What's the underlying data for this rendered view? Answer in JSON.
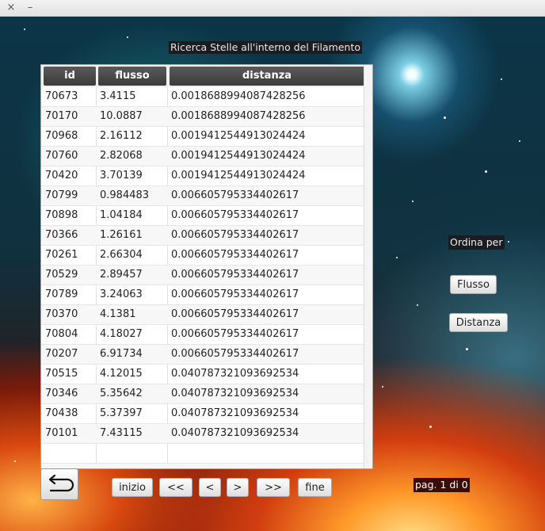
{
  "window": {
    "close_glyph": "×",
    "minimize_glyph": "–"
  },
  "title": "Ricerca Stelle all'interno del Filamento",
  "table": {
    "headers": [
      "id",
      "flusso",
      "distanza"
    ],
    "rows": [
      [
        "70673",
        "3.4115",
        "0.0018688994087428256"
      ],
      [
        "70170",
        "10.0887",
        "0.0018688994087428256"
      ],
      [
        "70968",
        "2.16112",
        "0.0019412544913024424"
      ],
      [
        "70760",
        "2.82068",
        "0.0019412544913024424"
      ],
      [
        "70420",
        "3.70139",
        "0.0019412544913024424"
      ],
      [
        "70799",
        "0.984483",
        "0.006605795334402617"
      ],
      [
        "70898",
        "1.04184",
        "0.006605795334402617"
      ],
      [
        "70366",
        "1.26161",
        "0.006605795334402617"
      ],
      [
        "70261",
        "2.66304",
        "0.006605795334402617"
      ],
      [
        "70529",
        "2.89457",
        "0.006605795334402617"
      ],
      [
        "70789",
        "3.24063",
        "0.006605795334402617"
      ],
      [
        "70370",
        "4.1381",
        "0.006605795334402617"
      ],
      [
        "70804",
        "4.18027",
        "0.006605795334402617"
      ],
      [
        "70207",
        "6.91734",
        "0.006605795334402617"
      ],
      [
        "70515",
        "4.12015",
        "0.040787321093692534"
      ],
      [
        "70346",
        "5.35642",
        "0.040787321093692534"
      ],
      [
        "70438",
        "5.37397",
        "0.040787321093692534"
      ],
      [
        "70101",
        "7.43115",
        "0.040787321093692534"
      ]
    ],
    "empty_rows": 2
  },
  "sort": {
    "label": "Ordina per",
    "flux_button": "Flusso",
    "distance_button": "Distanza"
  },
  "pagination": {
    "first": "inizio",
    "prev_fast": "<<",
    "prev": "<",
    "next": ">",
    "next_fast": ">>",
    "last": "fine",
    "page_status": "pag. 1 di 0"
  },
  "icons": {
    "back": "return-arrow-icon",
    "close": "close-icon",
    "minimize": "minimize-icon"
  }
}
